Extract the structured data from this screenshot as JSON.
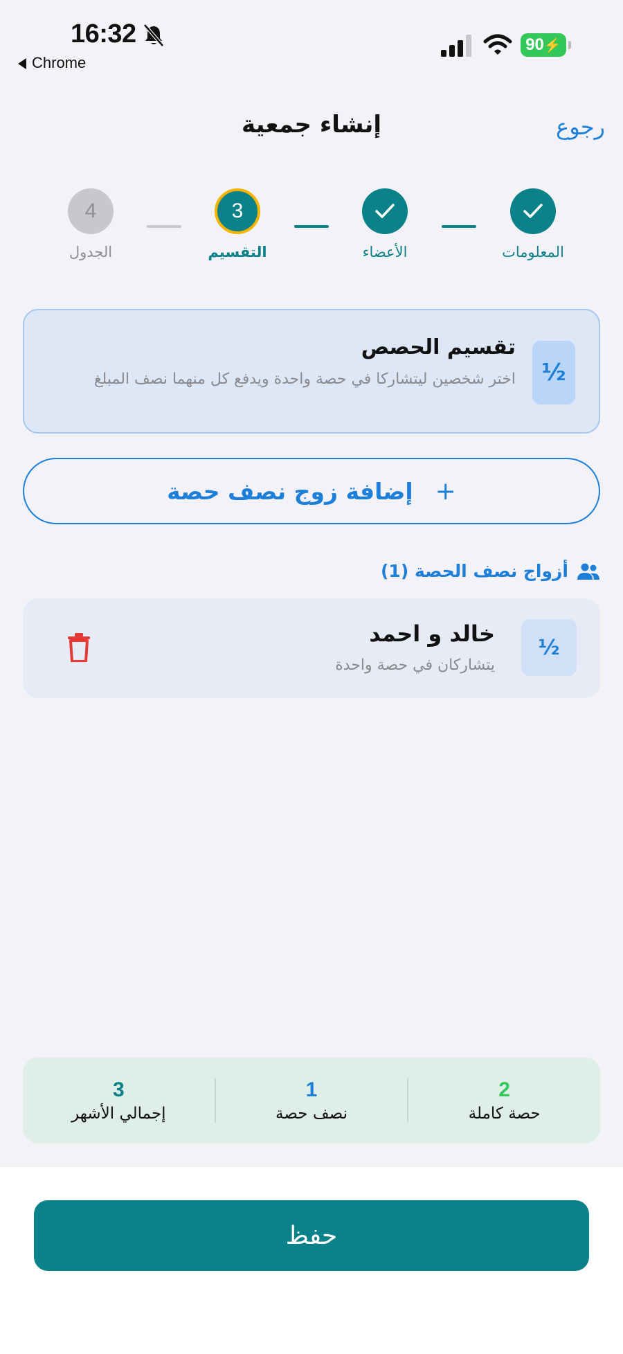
{
  "status_bar": {
    "time": "16:32",
    "back_app": "Chrome",
    "battery": "90"
  },
  "header": {
    "title": "إنشاء جمعية",
    "back_label": "رجوع"
  },
  "stepper": {
    "steps": [
      {
        "label": "المعلومات",
        "state": "done"
      },
      {
        "label": "الأعضاء",
        "state": "done"
      },
      {
        "label": "التقسيم",
        "number": "3",
        "state": "active"
      },
      {
        "label": "الجدول",
        "number": "4",
        "state": "pending"
      }
    ]
  },
  "info_card": {
    "badge": "½",
    "title": "تقسيم الحصص",
    "description": "اختر شخصين ليتشاركا في حصة واحدة ويدفع كل منهما نصف المبلغ"
  },
  "add_pair_button": {
    "label": "إضافة زوج نصف حصة",
    "icon": "plus-icon"
  },
  "pairs_section": {
    "title": "أزواج نصف الحصة (1)",
    "icon": "people-icon",
    "items": [
      {
        "badge": "½",
        "name": "خالد و احمد",
        "subtitle": "يتشاركان في حصة واحدة",
        "icon": "trash-icon"
      }
    ]
  },
  "stats": [
    {
      "value": "2",
      "label": "حصة كاملة",
      "color": "#34c759"
    },
    {
      "value": "1",
      "label": "نصف حصة",
      "color": "#1e7fd8"
    },
    {
      "value": "3",
      "label": "إجمالي الأشهر",
      "color": "#0b8189"
    }
  ],
  "save_button": {
    "label": "حفظ"
  },
  "colors": {
    "primary": "#0b8189",
    "accent": "#1e7fd8",
    "active_ring": "#f4b400",
    "danger": "#e53935"
  }
}
